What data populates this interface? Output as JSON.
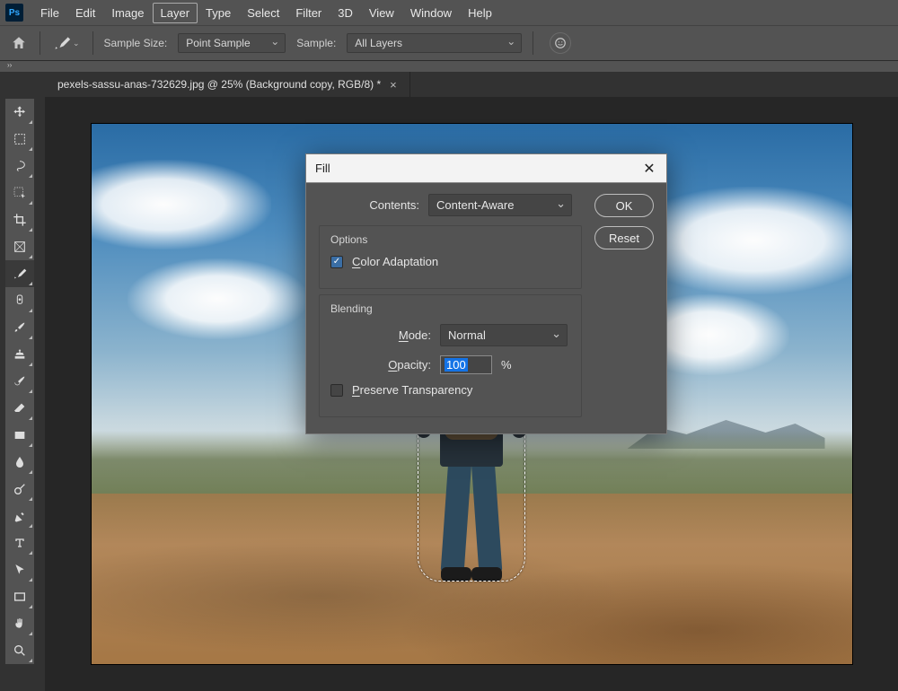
{
  "menubar": [
    "File",
    "Edit",
    "Image",
    "Layer",
    "Type",
    "Select",
    "Filter",
    "3D",
    "View",
    "Window",
    "Help"
  ],
  "menubar_active": "Layer",
  "optionsbar": {
    "sample_size_label": "Sample Size:",
    "sample_size_value": "Point Sample",
    "sample_label": "Sample:",
    "sample_value": "All Layers"
  },
  "document_tab": {
    "title": "pexels-sassu-anas-732629.jpg @ 25% (Background copy, RGB/8) *"
  },
  "dialog": {
    "title": "Fill",
    "contents_label": "Contents:",
    "contents_value": "Content-Aware",
    "options_title": "Options",
    "color_adaptation_label": "Color Adaptation",
    "color_adaptation_checked": true,
    "blending_title": "Blending",
    "mode_label": "Mode:",
    "mode_value": "Normal",
    "opacity_label": "Opacity:",
    "opacity_value": "100",
    "opacity_suffix": "%",
    "preserve_label": "Preserve Transparency",
    "preserve_checked": false,
    "ok": "OK",
    "reset": "Reset"
  },
  "tools": [
    "move-tool",
    "rectangular-marquee-tool",
    "lasso-tool",
    "object-selection-tool",
    "crop-tool",
    "frame-tool",
    "eyedropper-tool",
    "spot-healing-tool",
    "brush-tool",
    "clone-stamp-tool",
    "history-brush-tool",
    "eraser-tool",
    "gradient-tool",
    "blur-tool",
    "dodge-tool",
    "pen-tool",
    "type-tool",
    "path-selection-tool",
    "rectangle-tool",
    "hand-tool",
    "zoom-tool"
  ],
  "active_tool": "eyedropper-tool",
  "ps_logo": "Ps"
}
